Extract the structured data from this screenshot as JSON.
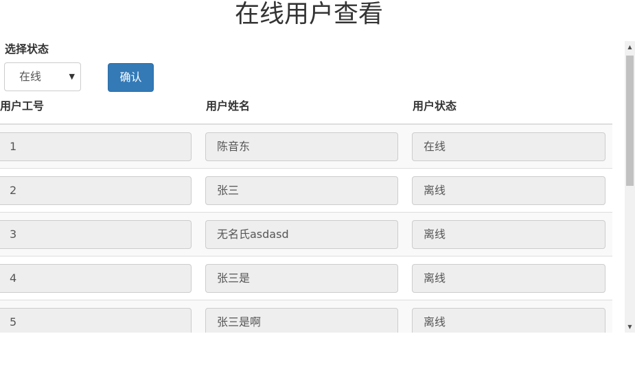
{
  "page": {
    "title": "在线用户查看"
  },
  "filter": {
    "label": "选择状态",
    "selected": "在线",
    "arrow_icon": "▼",
    "confirm_label": "确认"
  },
  "table": {
    "headers": [
      "用户工号",
      "用户姓名",
      "用户状态"
    ],
    "rows": [
      {
        "id": "1",
        "name": "陈音东",
        "status": "在线"
      },
      {
        "id": "2",
        "name": "张三",
        "status": "离线"
      },
      {
        "id": "3",
        "name": "无名氏asdasd",
        "status": "离线"
      },
      {
        "id": "4",
        "name": "张三是",
        "status": "离线"
      },
      {
        "id": "5",
        "name": "张三是啊",
        "status": "离线"
      }
    ]
  },
  "scrollbar": {
    "up_icon": "▲",
    "down_icon": "▼"
  },
  "colors": {
    "primary_button": "#337ab7",
    "readonly_input": "#eeeeee",
    "striped_row": "#f9f9f9"
  }
}
